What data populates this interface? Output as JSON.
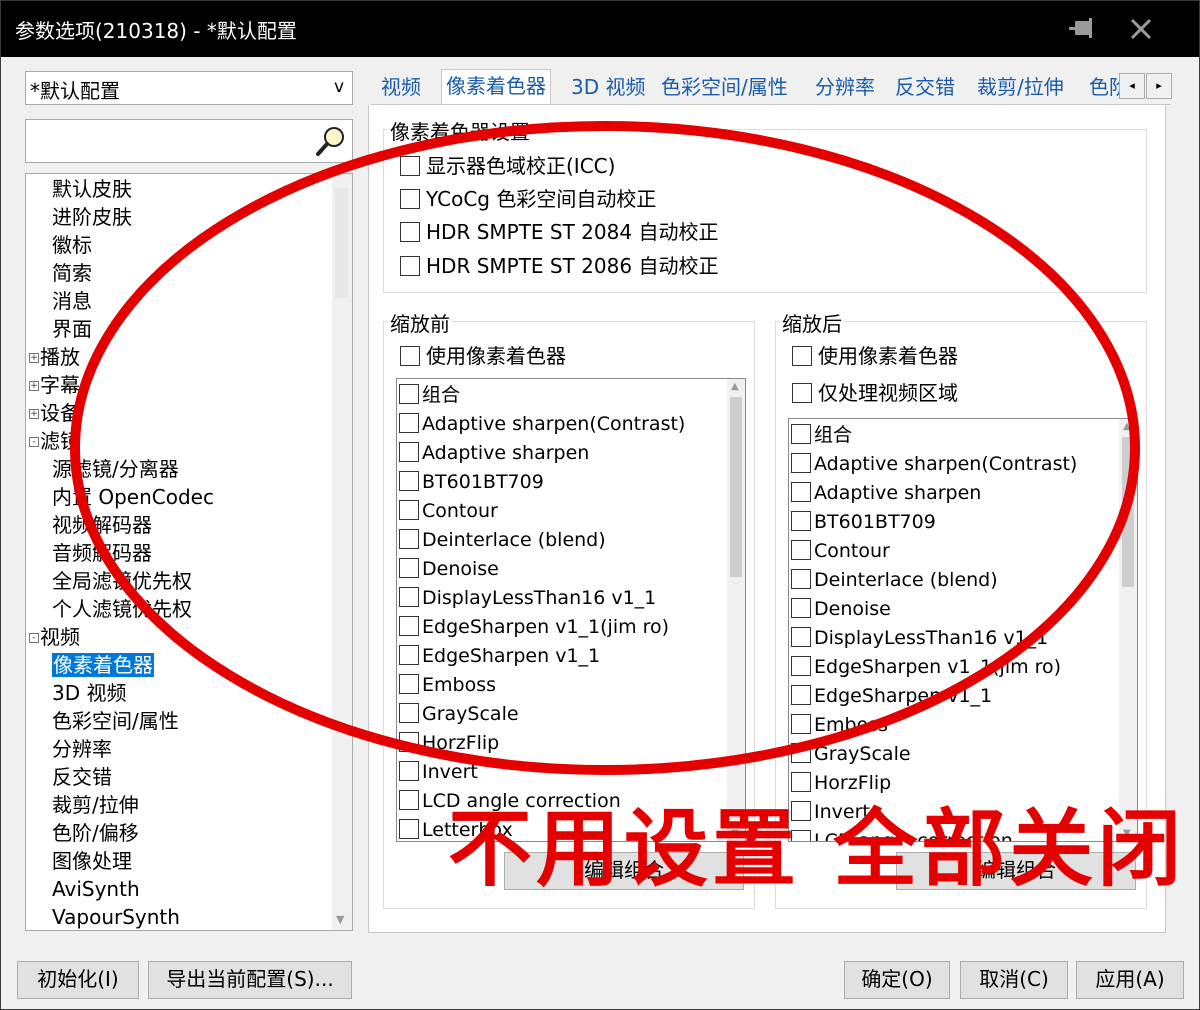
{
  "window": {
    "title": "参数选项(210318) - *默认配置"
  },
  "profile": {
    "selected": "*默认配置",
    "arrow": "v"
  },
  "search": {
    "value": "",
    "placeholder": ""
  },
  "tree": [
    {
      "label": "默认皮肤",
      "expander": ""
    },
    {
      "label": "进阶皮肤",
      "expander": ""
    },
    {
      "label": "徽标",
      "expander": ""
    },
    {
      "label": "简索",
      "expander": ""
    },
    {
      "label": "消息",
      "expander": ""
    },
    {
      "label": "界面",
      "expander": ""
    },
    {
      "label": "播放",
      "expander": "+"
    },
    {
      "label": "字幕",
      "expander": "+"
    },
    {
      "label": "设备",
      "expander": "+"
    },
    {
      "label": "滤镜",
      "expander": "-"
    },
    {
      "label": "源滤镜/分离器",
      "expander": ""
    },
    {
      "label": "内置 OpenCodec",
      "expander": ""
    },
    {
      "label": "视频解码器",
      "expander": ""
    },
    {
      "label": "音频解码器",
      "expander": ""
    },
    {
      "label": "全局滤镜优先权",
      "expander": ""
    },
    {
      "label": "个人滤镜优先权",
      "expander": ""
    },
    {
      "label": "视频",
      "expander": "-"
    },
    {
      "label": "像素着色器",
      "expander": "",
      "selected": true
    },
    {
      "label": "3D 视频",
      "expander": ""
    },
    {
      "label": "色彩空间/属性",
      "expander": ""
    },
    {
      "label": "分辨率",
      "expander": ""
    },
    {
      "label": "反交错",
      "expander": ""
    },
    {
      "label": "裁剪/拉伸",
      "expander": ""
    },
    {
      "label": "色阶/偏移",
      "expander": ""
    },
    {
      "label": "图像处理",
      "expander": ""
    },
    {
      "label": "AviSynth",
      "expander": ""
    },
    {
      "label": "VapourSynth",
      "expander": ""
    }
  ],
  "tabs": [
    "视频",
    "像素着色器",
    "3D 视频",
    "色彩空间/属性",
    "分辨率",
    "反交错",
    "裁剪/拉伸",
    "色阶"
  ],
  "tab_scroll": {
    "left": "◂",
    "right": "▸"
  },
  "shader_settings": {
    "title": "像素着色器设置",
    "options": [
      "显示器色域校正(ICC)",
      "YCoCg 色彩空间自动校正",
      "HDR SMPTE ST 2084 自动校正",
      "HDR SMPTE ST 2086 自动校正"
    ]
  },
  "pre_resize": {
    "title": "缩放前",
    "use_shader": "使用像素着色器",
    "items": [
      "组合",
      "Adaptive sharpen(Contrast)",
      "Adaptive sharpen",
      "BT601BT709",
      "Contour",
      "Deinterlace (blend)",
      "Denoise",
      "DisplayLessThan16 v1_1",
      "EdgeSharpen v1_1(jim ro)",
      "EdgeSharpen v1_1",
      "Emboss",
      "GrayScale",
      "HorzFlip",
      "Invert",
      "LCD angle correction",
      "Letterbox"
    ],
    "edit_button": "编辑组合"
  },
  "post_resize": {
    "title": "缩放后",
    "use_shader": "使用像素着色器",
    "video_area_only": "仅处理视频区域",
    "items": [
      "组合",
      "Adaptive sharpen(Contrast)",
      "Adaptive sharpen",
      "BT601BT709",
      "Contour",
      "Deinterlace (blend)",
      "Denoise",
      "DisplayLessThan16 v1_1",
      "EdgeSharpen v1_1(jim ro)",
      "EdgeSharpen v1_1",
      "Emboss",
      "GrayScale",
      "HorzFlip",
      "Invert",
      "LCD angle correction"
    ],
    "edit_button": "编辑组合"
  },
  "footer": {
    "init_button": "初始化(I)",
    "export_button": "导出当前配置(S)...",
    "ok_button": "确定(O)",
    "cancel_button": "取消(C)",
    "apply_button": "应用(A)"
  },
  "annotation": {
    "text": "不用设置 全部关闭",
    "color": "#e50000"
  }
}
